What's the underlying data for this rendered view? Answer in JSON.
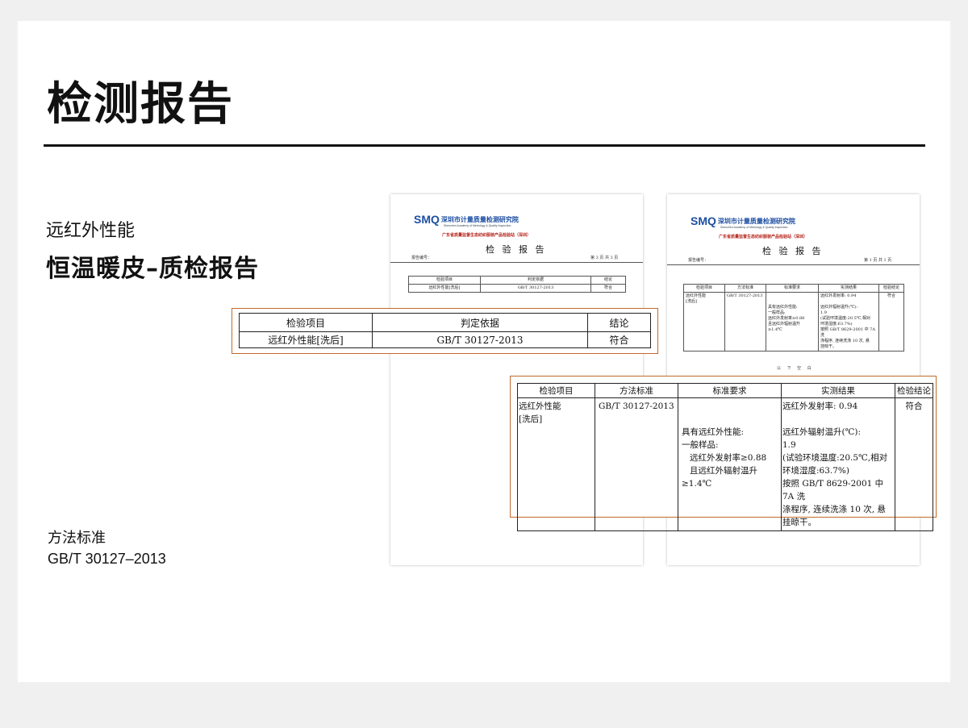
{
  "heading": {
    "title": "检测报告"
  },
  "product": {
    "subtitle": "远红外性能",
    "name": "恒温暖皮–质检报告"
  },
  "method": {
    "label": "方法标准",
    "value": "GB/T 30127–2013"
  },
  "report": {
    "logo_mark": "SMQ",
    "org_cn": "深圳市计量质量检测研究院",
    "org_en": "Shenzhen Academy of Metrology & Quality Inspection",
    "cert_line": "广东省质量监督生态纺织服装产品检验站（深圳）",
    "title": "检 验 报 告",
    "report_no_label": "报告编号：",
    "page1_no": "第 3 页 共 3 页",
    "page2_no": "第 1 页 共 1 页",
    "end_mark": "以 下 空 白"
  },
  "table1": {
    "headers": [
      "检验项目",
      "判定依据",
      "结论"
    ],
    "row": [
      "远红外性能[洗后]",
      "GB/T 30127-2013",
      "符合"
    ]
  },
  "table2": {
    "headers": [
      "检验项目",
      "方法标准",
      "标准要求",
      "实测结果",
      "检验结论"
    ],
    "item": [
      "远红外性能",
      "[洗后]"
    ],
    "method": "GB/T 30127-2013",
    "requirement": [
      "具有远红外性能:",
      "一般样品:",
      "远红外发射率≥0.88",
      "且远红外辐射温升",
      "≥1.4℃"
    ],
    "result": [
      "远红外发射率: 0.94",
      "远红外辐射温升(℃):",
      "1.9",
      "(试验环境温度:20.5℃,相对",
      "环境湿度:63.7%)",
      "按照 GB/T 8629-2001 中 7A 洗",
      "涤程序, 连续洗涤 10 次, 悬",
      "挂晾干。"
    ],
    "conclusion": "符合"
  },
  "colors": {
    "accent_border": "#c06a2d",
    "logo_blue": "#1d4fa3",
    "cert_red": "#b5241b"
  }
}
